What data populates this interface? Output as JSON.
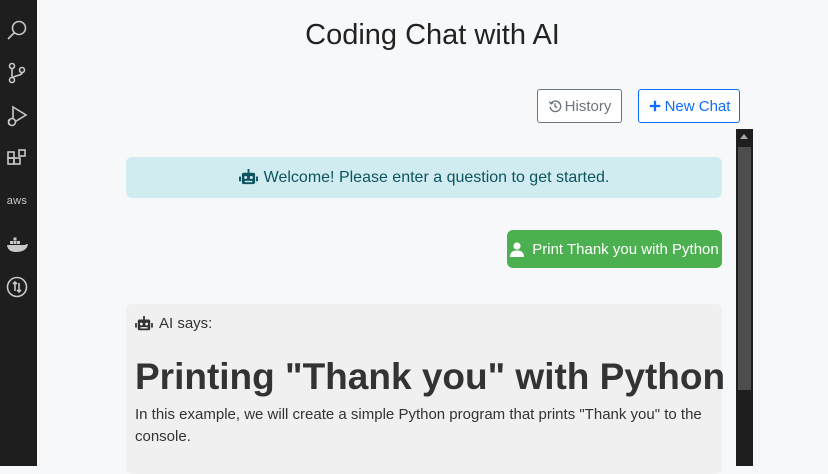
{
  "activity_bar": {
    "icons": [
      "search-icon",
      "source-control-icon",
      "run-debug-icon",
      "extensions-icon",
      "aws-icon",
      "docker-icon",
      "scm-compare-icon"
    ],
    "aws_label": "aws"
  },
  "app": {
    "title": "Coding Chat with AI"
  },
  "toolbar": {
    "history_label": "History",
    "new_chat_label": "New Chat"
  },
  "welcome": {
    "text": "Welcome! Please enter a question to get started."
  },
  "messages": {
    "user": {
      "text": "Print Thank you with Python"
    },
    "ai": {
      "label": "AI says:",
      "heading": "Printing \"Thank you\" with Python",
      "paragraph": "In this example, we will create a simple Python program that prints \"Thank you\" to the console."
    }
  },
  "colors": {
    "activity_bar_bg": "#1e1e1e",
    "page_bg": "#f7f8fa",
    "alert_bg": "#d1ecf1",
    "alert_text": "#0c5460",
    "user_msg_bg": "#4caf50",
    "ai_card_bg": "#f0f0f0",
    "primary": "#0d6efd",
    "secondary": "#6c757d"
  }
}
